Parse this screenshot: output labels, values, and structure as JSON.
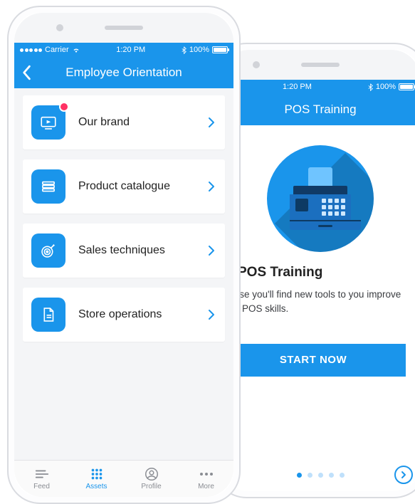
{
  "colors": {
    "accent": "#1a95eb",
    "badge": "#ff3264"
  },
  "phone_left": {
    "status": {
      "carrier": "Carrier",
      "time": "1:20 PM",
      "battery_pct": "100%"
    },
    "title": "Employee Orientation",
    "rows": [
      {
        "label": "Our brand",
        "icon": "play-screen-icon",
        "has_badge": true
      },
      {
        "label": "Product catalogue",
        "icon": "stack-icon"
      },
      {
        "label": "Sales techniques",
        "icon": "target-icon"
      },
      {
        "label": "Store operations",
        "icon": "document-icon"
      }
    ],
    "tabs": [
      {
        "label": "Feed",
        "icon": "feed-icon"
      },
      {
        "label": "Assets",
        "icon": "grid-icon",
        "active": true
      },
      {
        "label": "Profile",
        "icon": "profile-icon"
      },
      {
        "label": "More",
        "icon": "more-icon"
      }
    ]
  },
  "phone_right": {
    "status": {
      "time": "1:20 PM",
      "battery_pct": "100%"
    },
    "title": "POS Training",
    "course": {
      "title": "POS Training",
      "description": "course you'll find new tools to you improve your POS skills.",
      "cta": "START NOW"
    },
    "pager": {
      "count": 5,
      "active_index": 0
    }
  }
}
